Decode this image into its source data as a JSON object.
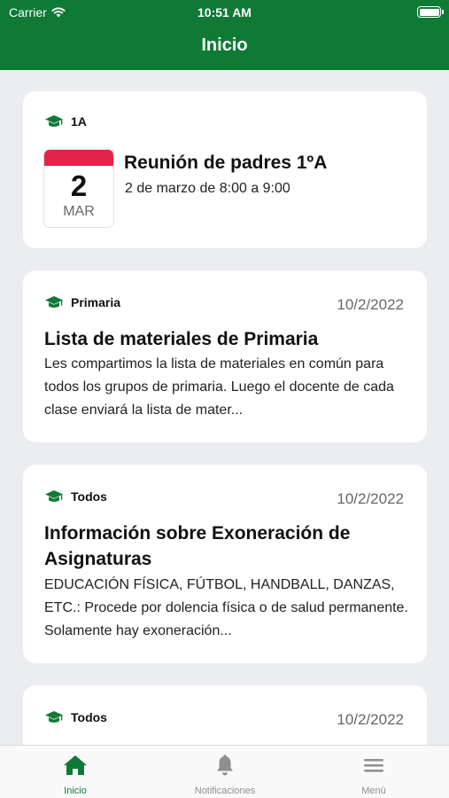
{
  "status_bar": {
    "carrier": "Carrier",
    "time": "10:51 AM"
  },
  "nav": {
    "title": "Inicio"
  },
  "colors": {
    "brand": "#0e7a36",
    "calendar_accent": "#e4234a",
    "background": "#ebedf0"
  },
  "event_card": {
    "tag": "1A",
    "tag_icon": "graduation-cap-icon",
    "day": "2",
    "month": "MAR",
    "title": "Reunión de padres 1ºA",
    "time": "2 de marzo de 8:00 a 9:00"
  },
  "posts": [
    {
      "tag": "Primaria",
      "tag_icon": "graduation-cap-icon",
      "date": "10/2/2022",
      "title": "Lista de materiales de Primaria",
      "body": "Les compartimos la lista de materiales en común para todos los grupos de primaria. Luego el docente de cada clase enviará la lista de mater..."
    },
    {
      "tag": "Todos",
      "tag_icon": "graduation-cap-icon",
      "date": "10/2/2022",
      "title": "Información sobre Exoneración de Asignaturas",
      "body": "EDUCACIÓN FÍSICA, FÚTBOL, HANDBALL, DANZAS, ETC.: Procede por dolencia física o de salud permanente. Solamente hay exoneración..."
    },
    {
      "tag": "Todos",
      "tag_icon": "graduation-cap-icon",
      "date": "10/2/2022"
    }
  ],
  "tabbar": {
    "tabs": [
      {
        "label": "Inicio",
        "icon": "home-icon",
        "active": true
      },
      {
        "label": "Notificaciones",
        "icon": "bell-icon",
        "active": false
      },
      {
        "label": "Menú",
        "icon": "hamburger-menu-icon",
        "active": false
      }
    ]
  }
}
